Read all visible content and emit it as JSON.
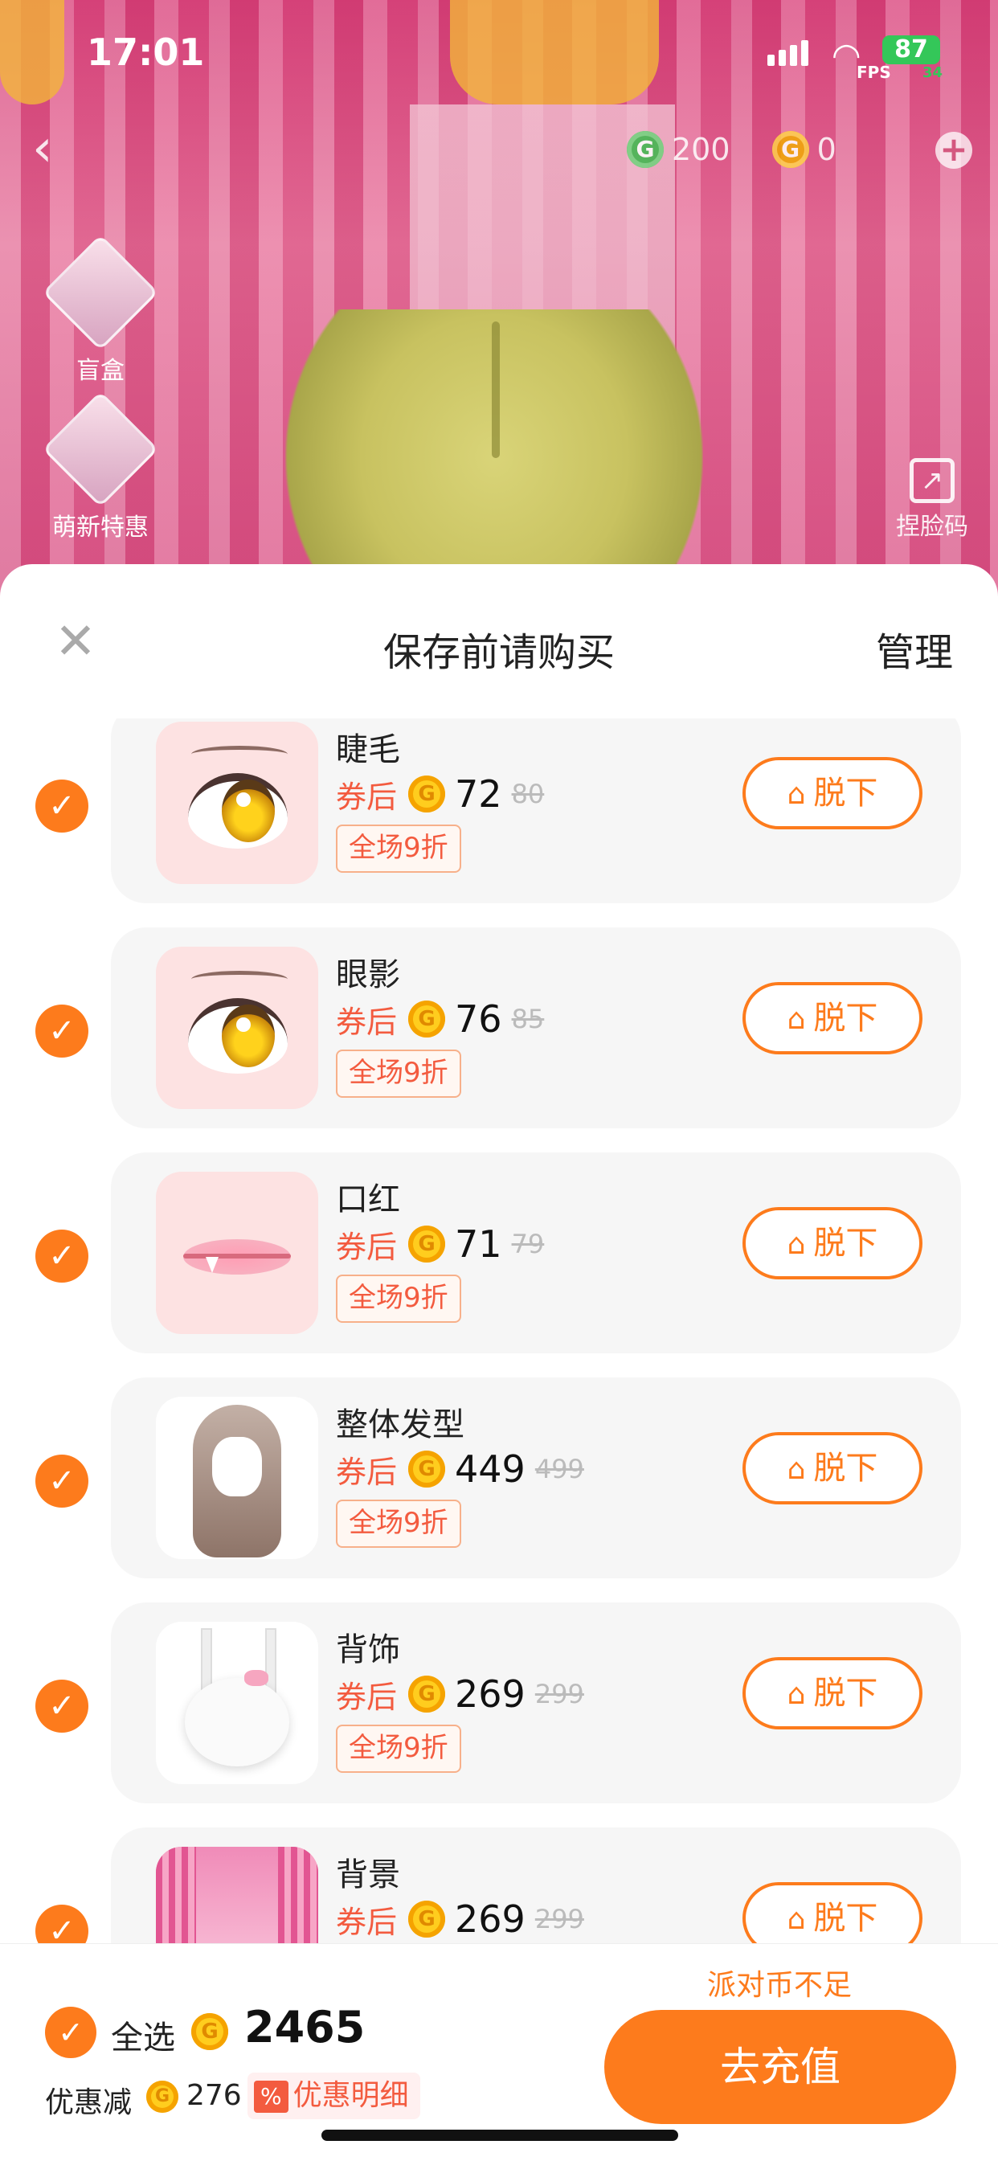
{
  "status_bar": {
    "time": "17:01",
    "fps_label": "FPS",
    "battery": "87",
    "battery_sub": "34"
  },
  "header": {
    "currency": [
      {
        "icon": "green-coin-icon",
        "amount": "200"
      },
      {
        "icon": "gold-coin-icon",
        "amount": "0"
      }
    ],
    "coin_glyph": "G",
    "side_entries": [
      {
        "label": "盲盒"
      },
      {
        "label": "萌新特惠"
      }
    ],
    "face_code_label": "捏脸码"
  },
  "sheet": {
    "title": "保存前请购买",
    "manage_label": "管理",
    "after_coupon_label": "券后",
    "discount_tag": "全场9折",
    "remove_label": "脱下",
    "items": [
      {
        "name": "睫毛",
        "price": "72",
        "original": "80",
        "art": "eyelash"
      },
      {
        "name": "眼影",
        "price": "76",
        "original": "85",
        "art": "eyeshadow"
      },
      {
        "name": "口红",
        "price": "71",
        "original": "79",
        "art": "lipstick"
      },
      {
        "name": "整体发型",
        "price": "449",
        "original": "499",
        "art": "hairstyle"
      },
      {
        "name": "背饰",
        "price": "269",
        "original": "299",
        "art": "backpack"
      },
      {
        "name": "背景",
        "price": "269",
        "original": "299",
        "art": "background"
      }
    ]
  },
  "footer": {
    "insufficient": "派对币不足",
    "select_all_label": "全选",
    "total": "2465",
    "discount_label": "优惠减",
    "discount_amount": "276",
    "detail_label": "优惠明细",
    "detail_badge": "%",
    "recharge_label": "去充值"
  },
  "colors": {
    "accent": "#fd7b1c",
    "price_red": "#f35b3f"
  }
}
